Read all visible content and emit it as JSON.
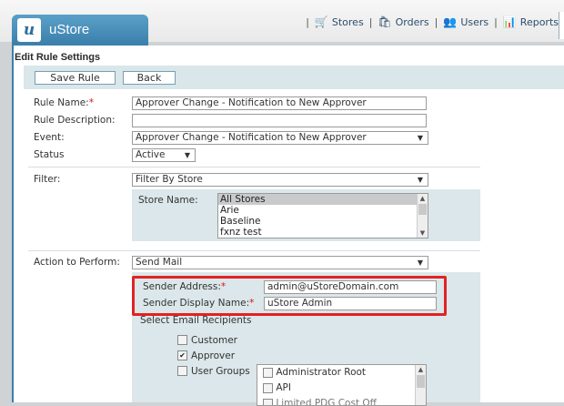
{
  "app": {
    "name": "uStore",
    "logo_letter": "u"
  },
  "nav": [
    {
      "label": "Stores",
      "icon": "cart-icon"
    },
    {
      "label": "Orders",
      "icon": "orders-icon"
    },
    {
      "label": "Users",
      "icon": "users-icon"
    },
    {
      "label": "Reports",
      "icon": "reports-icon"
    }
  ],
  "page": {
    "title": "Edit Rule Settings"
  },
  "toolbar": {
    "save_label": "Save Rule",
    "back_label": "Back"
  },
  "form": {
    "rule_name_label": "Rule Name:",
    "required_mark": "*",
    "rule_name_value": "Approver Change - Notification to New Approver",
    "description_label": "Rule Description:",
    "description_value": "",
    "event_label": "Event:",
    "event_value": "Approver Change - Notification to New Approver",
    "status_label": "Status",
    "status_value": "Active",
    "filter_label": "Filter:",
    "filter_value": "Filter By Store",
    "store_name_label": "Store Name:",
    "stores": [
      "All Stores",
      "Arie",
      "Baseline",
      "fxnz test"
    ],
    "action_label": "Action to Perform:",
    "action_value": "Send Mail",
    "sender_address_label": "Sender Address:",
    "sender_address_value": "admin@uStoreDomain.com",
    "sender_display_label": "Sender Display Name:",
    "sender_display_value": "uStore Admin",
    "recipients_label": "Select Email Recipients",
    "recipients": [
      {
        "label": "Customer",
        "checked": false
      },
      {
        "label": "Approver",
        "checked": true
      },
      {
        "label": "User Groups",
        "checked": false
      }
    ],
    "groups": [
      "Administrator Root",
      "API",
      "Limited PDG Cost Off"
    ]
  },
  "colors": {
    "accent": "#3a7fab",
    "panel": "#dbe7ea",
    "highlight": "#e32222"
  }
}
